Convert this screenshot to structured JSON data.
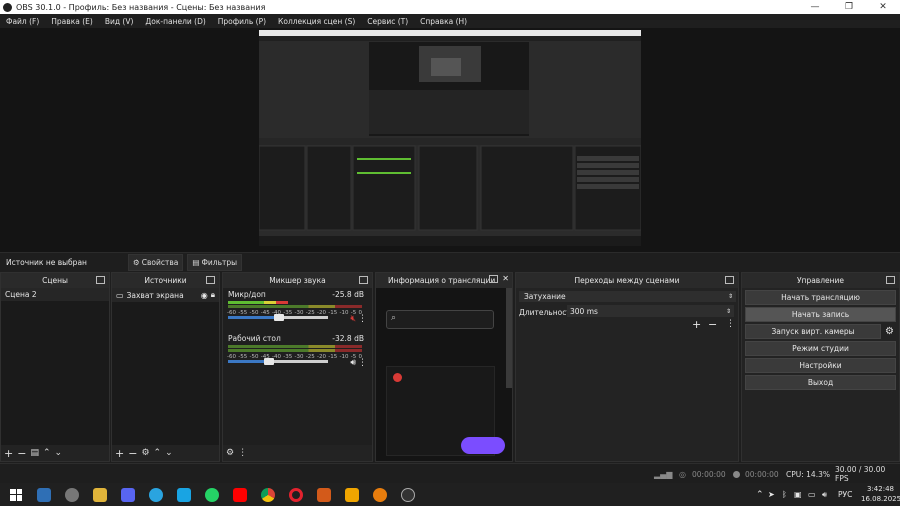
{
  "window": {
    "title": "OBS 30.1.0 - Профиль: Без названия - Сцены: Без названия",
    "minimize": "—",
    "restore": "❐",
    "close": "✕"
  },
  "menu": [
    "Файл (F)",
    "Правка (E)",
    "Вид (V)",
    "Док-панели (D)",
    "Профиль (P)",
    "Коллекция сцен (S)",
    "Сервис (T)",
    "Справка (H)"
  ],
  "source_bar": {
    "no_source": "Источник не выбран",
    "properties": "Свойства",
    "filters": "Фильтры"
  },
  "docks": {
    "scenes": {
      "title": "Сцены",
      "items": [
        "Сцена 2"
      ]
    },
    "sources": {
      "title": "Источники",
      "items": [
        "Захват экрана"
      ]
    },
    "mixer": {
      "title": "Микшер звука",
      "channels": [
        {
          "name": "Микр/доп",
          "db": "-25.8 dB",
          "muted": true,
          "level": 0.5
        },
        {
          "name": "Рабочий стол",
          "db": "-32.8 dB",
          "muted": false,
          "level": 0.4
        }
      ],
      "scale": [
        "-60",
        "-55",
        "-50",
        "-45",
        "-40",
        "-35",
        "-30",
        "-25",
        "-20",
        "-15",
        "-10",
        "-5",
        "0"
      ]
    },
    "stream_info": {
      "title": "Информация о трансляции"
    },
    "transitions": {
      "title": "Переходы между сценами",
      "type": "Затухание",
      "duration_label": "Длительность",
      "duration_value": "300 ms"
    },
    "controls": {
      "title": "Управление",
      "buttons": [
        "Начать трансляцию",
        "Начать запись",
        "Запуск вирт. камеры",
        "Режим студии",
        "Настройки",
        "Выход"
      ]
    }
  },
  "status": {
    "stream_time": "00:00:00",
    "rec_time": "00:00:00",
    "cpu": "CPU: 14.3%",
    "fps": "30.00 / 30.00 FPS"
  },
  "taskbar": {
    "lang": "РУС",
    "time": "3:42:48",
    "date": "16.08.2025"
  },
  "colors": {
    "accent_purple": "#7b4dff",
    "meter_green": "#5fbd32",
    "meter_yellow": "#d8d036",
    "meter_red": "#d83a36",
    "mute_red": "#d83a36"
  }
}
